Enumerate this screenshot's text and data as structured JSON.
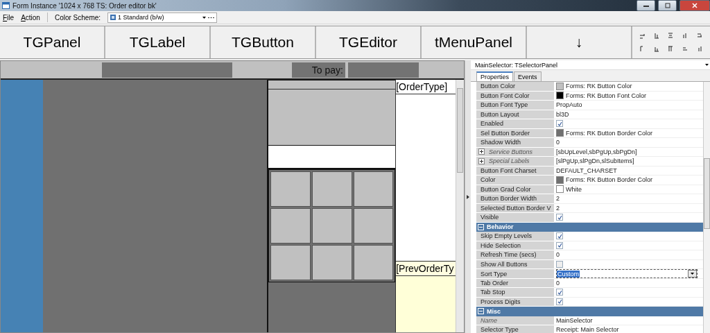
{
  "window": {
    "title": "Form Instance '1024 x 768 TS: Order editor bk'"
  },
  "menu": [
    {
      "label": "File"
    },
    {
      "label": "Action"
    }
  ],
  "color_scheme": {
    "label": "Color Scheme:",
    "value": "1 Standard (b/w)"
  },
  "palette": [
    "TGPanel",
    "TGLabel",
    "TGButton",
    "TGEditor",
    "tMenuPanel",
    "↓"
  ],
  "form": {
    "to_pay": "To pay:",
    "order_type": "[OrderType]",
    "prev_order_type": "[PrevOrderTy"
  },
  "inspector": {
    "object": "MainSelector: TSelectorPanel",
    "tabs": [
      {
        "label": "Properties",
        "selected": true
      },
      {
        "label": "Events",
        "selected": false
      }
    ],
    "rows": [
      {
        "kind": "color",
        "name": "Button Color",
        "value": "Forms: RK Button Color",
        "color": "#c0c0c0"
      },
      {
        "kind": "color",
        "name": "Button Font Color",
        "value": "Forms: RK Button Font Color",
        "color": "#000000"
      },
      {
        "kind": "text",
        "name": "Button Font Type",
        "value": "PropAuto"
      },
      {
        "kind": "text",
        "name": "Button Layout",
        "value": "bl3D"
      },
      {
        "kind": "check",
        "name": "Enabled",
        "checked": true
      },
      {
        "kind": "color",
        "name": "Sel Button Border",
        "value": "Forms: RK Button Border Color",
        "color": "#707070"
      },
      {
        "kind": "text",
        "name": "Shadow Width",
        "value": "0"
      },
      {
        "kind": "expandable",
        "name": "Service Buttons",
        "value": "[sbUpLevel,sbPgUp,sbPgDn]",
        "expanded": false
      },
      {
        "kind": "expandable",
        "name": "Special Labels",
        "value": "[slPgUp,slPgDn,slSubItems]",
        "expanded": false
      },
      {
        "kind": "text",
        "name": "Button Font Charset",
        "value": "DEFAULT_CHARSET"
      },
      {
        "kind": "color",
        "name": "Color",
        "value": "Forms: RK Button Border Color",
        "color": "#707070"
      },
      {
        "kind": "color",
        "name": "Button Grad Color",
        "value": "White",
        "color": "#ffffff"
      },
      {
        "kind": "text",
        "name": "Button Border Width",
        "value": "2"
      },
      {
        "kind": "text",
        "name": "Selected Button Border V",
        "value": "2"
      },
      {
        "kind": "check",
        "name": "Visible",
        "checked": true
      },
      {
        "kind": "group",
        "name": "Behavior",
        "expanded": true
      },
      {
        "kind": "check",
        "name": "Skip Empty Levels",
        "checked": true
      },
      {
        "kind": "check",
        "name": "Hide Selection",
        "checked": true
      },
      {
        "kind": "text",
        "name": "Refresh Time (secs)",
        "value": "0"
      },
      {
        "kind": "check",
        "name": "Show All Buttons",
        "checked": false,
        "disabled": true
      },
      {
        "kind": "dropdown",
        "name": "Sort Type",
        "value": "Custom"
      },
      {
        "kind": "text",
        "name": "Tab Order",
        "value": "0"
      },
      {
        "kind": "check",
        "name": "Tab Stop",
        "checked": true
      },
      {
        "kind": "check",
        "name": "Process Digits",
        "checked": true
      },
      {
        "kind": "group",
        "name": "Misc",
        "expanded": true
      },
      {
        "kind": "readonly",
        "name": "Name",
        "value": "MainSelector"
      },
      {
        "kind": "text",
        "name": "Selector Type",
        "value": "Receipt: Main Selector"
      }
    ]
  }
}
